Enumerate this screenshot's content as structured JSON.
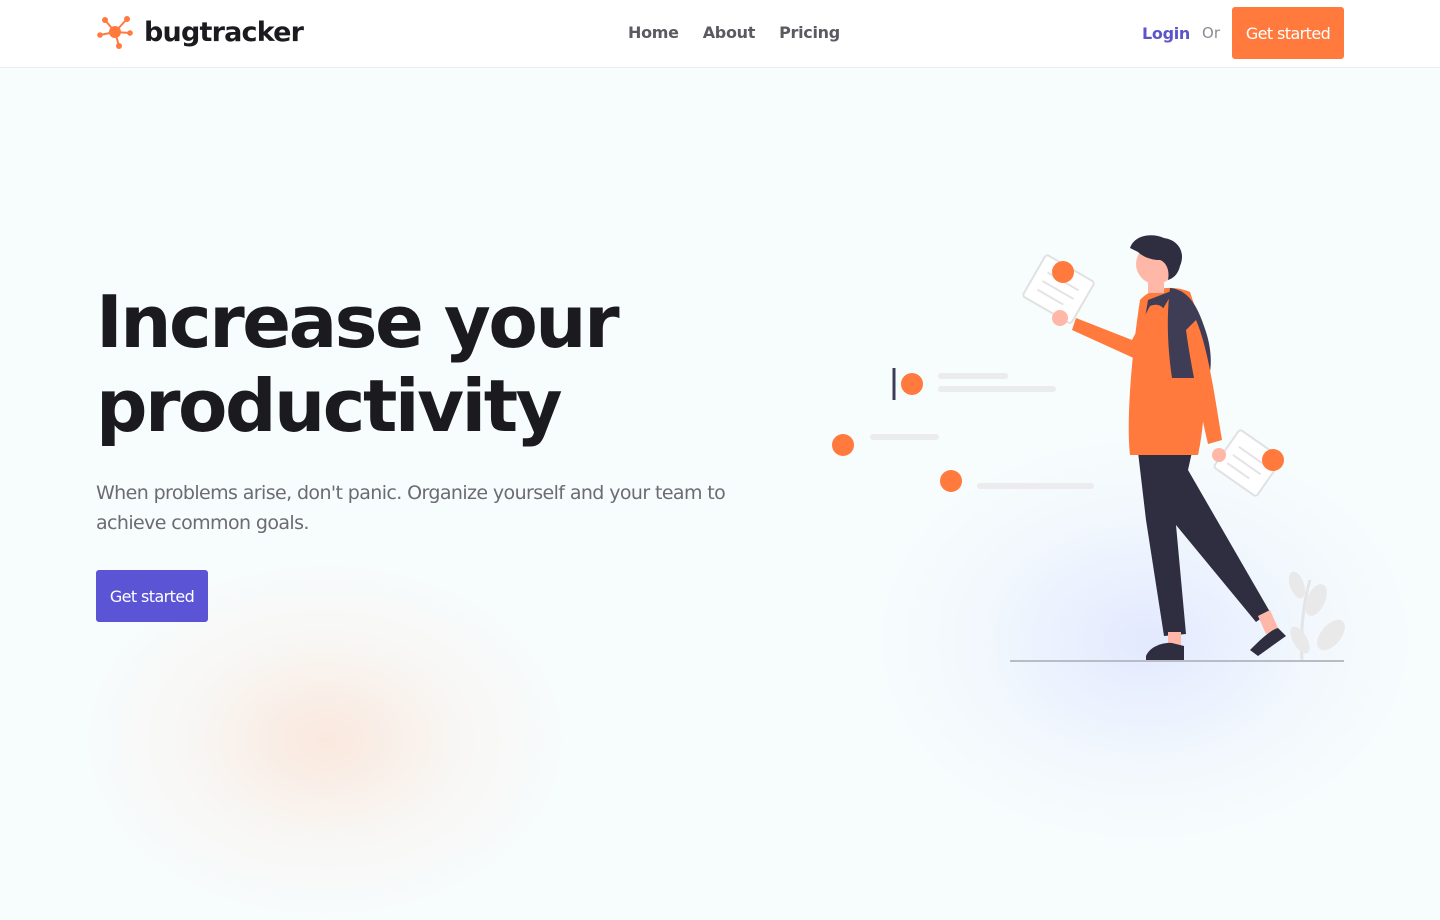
{
  "brand": {
    "name": "bugtracker",
    "logo_icon": "bug-network-logo-icon",
    "accent_color": "#ff7a3c"
  },
  "nav": {
    "links": [
      {
        "label": "Home"
      },
      {
        "label": "About"
      },
      {
        "label": "Pricing"
      }
    ],
    "login_label": "Login",
    "or_label": "Or",
    "cta_label": "Get started"
  },
  "hero": {
    "title_line1": "Increase your",
    "title_line2": "productivity",
    "description": "When problems arise, don't panic. Organize yourself and your team to achieve common goals.",
    "cta_label": "Get started",
    "cta_color": "#5b55d6",
    "illustration": "person-reading-documents-illustration"
  }
}
